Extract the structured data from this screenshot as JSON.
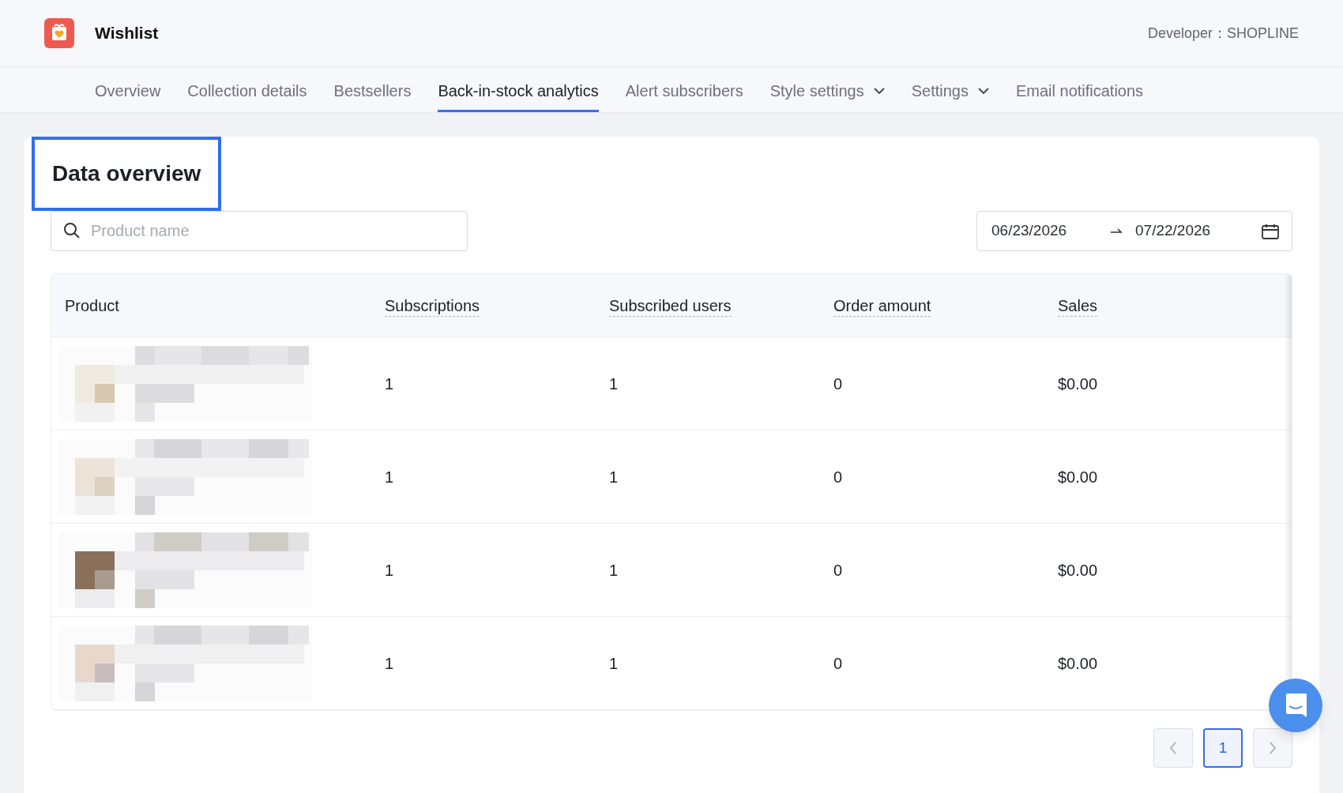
{
  "app": {
    "title": "Wishlist",
    "developer": "Developer：SHOPLINE"
  },
  "tabs": [
    {
      "label": "Overview",
      "selected": false,
      "has_menu": false
    },
    {
      "label": "Collection details",
      "selected": false,
      "has_menu": false
    },
    {
      "label": "Bestsellers",
      "selected": false,
      "has_menu": false
    },
    {
      "label": "Back-in-stock analytics",
      "selected": true,
      "has_menu": false
    },
    {
      "label": "Alert subscribers",
      "selected": false,
      "has_menu": false
    },
    {
      "label": "Style settings",
      "selected": false,
      "has_menu": true
    },
    {
      "label": "Settings",
      "selected": false,
      "has_menu": true
    },
    {
      "label": "Email notifications",
      "selected": false,
      "has_menu": false
    }
  ],
  "section": {
    "title": "Data overview",
    "highlighted": true
  },
  "search": {
    "placeholder": "Product name"
  },
  "date_range": {
    "start": "06/23/2026",
    "end": "07/22/2026"
  },
  "table": {
    "columns": [
      {
        "label": "Product",
        "dashed": false
      },
      {
        "label": "Subscriptions",
        "dashed": true
      },
      {
        "label": "Subscribed users",
        "dashed": true
      },
      {
        "label": "Order amount",
        "dashed": true
      },
      {
        "label": "Sales",
        "dashed": true
      }
    ],
    "rows": [
      {
        "cells": [
          {
            "kind": "picture"
          },
          "1",
          "1",
          "0",
          "$0.00"
        ]
      },
      {
        "cells": [
          {
            "kind": "picture"
          },
          "1",
          "1",
          "0",
          "$0.00"
        ]
      },
      {
        "cells": [
          {
            "kind": "picture"
          },
          "1",
          "1",
          "0",
          "$0.00"
        ]
      },
      {
        "cells": [
          {
            "kind": "picture"
          },
          "1",
          "1",
          "0",
          "$0.00"
        ]
      }
    ]
  },
  "pagination": {
    "prev_disabled": true,
    "next_disabled": true,
    "pages": [
      {
        "label": "1",
        "selected": true
      }
    ]
  }
}
